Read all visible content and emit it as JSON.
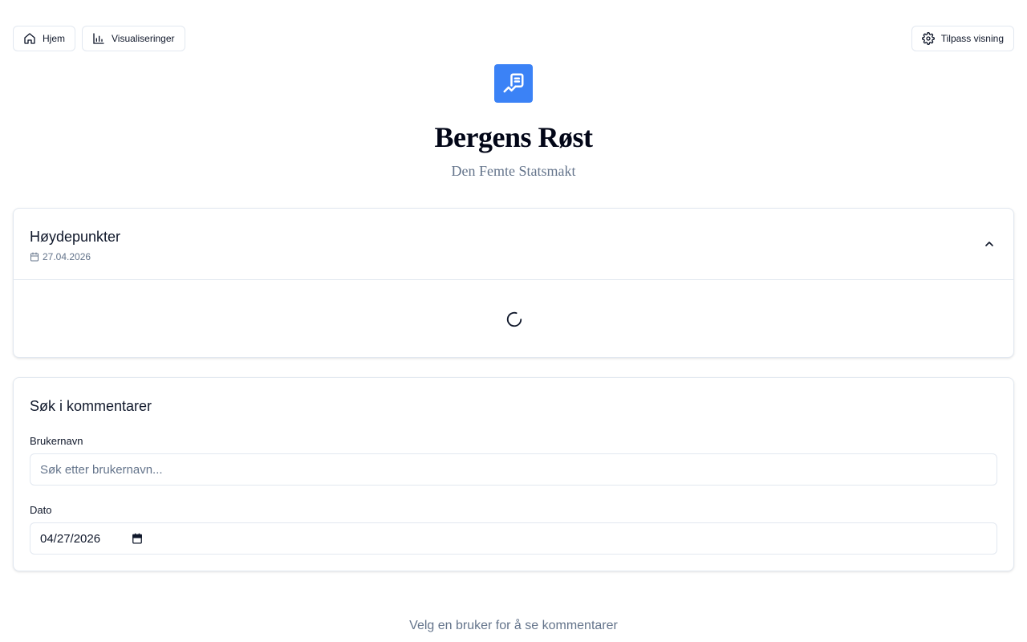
{
  "nav": {
    "home_label": "Hjem",
    "home_icon": "home-icon",
    "viz_label": "Visualiseringer",
    "viz_icon": "bar-chart-icon",
    "customize_label": "Tilpass visning",
    "customize_icon": "gear-icon"
  },
  "header": {
    "logo_icon": "receipt-chart-icon",
    "title": "Bergens Røst",
    "subtitle": "Den Femte Statsmakt"
  },
  "highlights": {
    "title": "Høydepunkter",
    "date": "27.04.2026",
    "collapse_icon": "chevron-up-icon",
    "loading_icon": "spinner-icon"
  },
  "search": {
    "title": "Søk i kommentarer",
    "username_label": "Brukernavn",
    "username_placeholder": "Søk etter brukernavn...",
    "username_value": "",
    "date_label": "Dato",
    "date_value": "04/27/2026"
  },
  "footer": {
    "message": "Velg en bruker for å se kommentarer"
  },
  "colors": {
    "accent": "#3b82f6",
    "muted_text": "#64748b",
    "border": "#e2e8f0"
  }
}
